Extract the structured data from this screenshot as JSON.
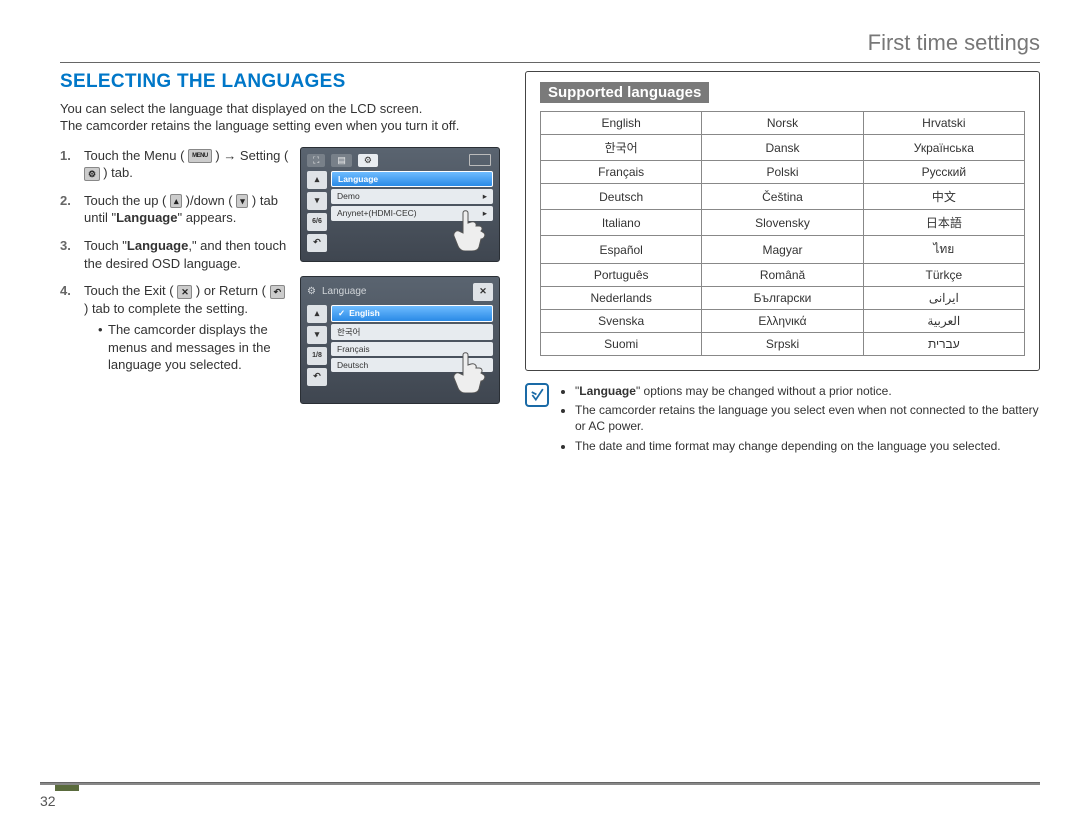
{
  "page_number": "32",
  "header": {
    "title": "First time settings"
  },
  "main": {
    "section_title": "SELECTING THE LANGUAGES",
    "intro_line1": "You can select the language that displayed on the LCD screen.",
    "intro_line2": "The camcorder retains the language setting even when you turn it off.",
    "steps": [
      {
        "num": "1.",
        "pre": "Touch the Menu (",
        "icon1_name": "menu-icon",
        "icon1_label": "MENU",
        "mid": " ) → Setting (",
        "icon2_name": "gear-icon",
        "icon2_label": "⚙",
        "post": " ) tab."
      },
      {
        "num": "2.",
        "pre": "Touch the up (",
        "icon1_name": "chevron-up-icon",
        "icon1_label": "▴",
        "mid": " )/down (",
        "icon2_name": "chevron-down-icon",
        "icon2_label": "▾",
        "post": " ) tab until \"",
        "bold": "Language",
        "tail": "\" appears."
      },
      {
        "num": "3.",
        "pre": "Touch \"",
        "bold": "Language",
        "post": ",\" and then touch the desired OSD language."
      },
      {
        "num": "4.",
        "pre": "Touch the Exit (",
        "icon1_name": "close-icon",
        "icon1_label": "✕",
        "mid": " ) or Return (",
        "icon2_name": "return-icon",
        "icon2_label": "↶",
        "post": " ) tab to complete the setting.",
        "bullet": "The camcorder displays the menus and messages in the language you selected."
      }
    ],
    "screenshot1": {
      "page_indicator": "6/6",
      "rows": [
        "Language",
        "Demo",
        "Anynet+(HDMI-CEC)"
      ],
      "title": ""
    },
    "screenshot2": {
      "title": "Language",
      "page_indicator": "1/8",
      "rows": [
        "English",
        "한국어",
        "Français",
        "Deutsch"
      ]
    }
  },
  "right": {
    "supported_title": "Supported languages",
    "languages": [
      [
        "English",
        "Norsk",
        "Hrvatski"
      ],
      [
        "한국어",
        "Dansk",
        "Українська"
      ],
      [
        "Français",
        "Polski",
        "Русский"
      ],
      [
        "Deutsch",
        "Čeština",
        "中文"
      ],
      [
        "Italiano",
        "Slovensky",
        "日本語"
      ],
      [
        "Español",
        "Magyar",
        "ไทย"
      ],
      [
        "Português",
        "Română",
        "Türkçe"
      ],
      [
        "Nederlands",
        "Български",
        "ايرانى"
      ],
      [
        "Svenska",
        "Ελληνικά",
        "العربية"
      ],
      [
        "Suomi",
        "Srpski",
        "עברית"
      ]
    ],
    "notes": [
      "\"Language\" options may be changed without a prior notice.",
      "The camcorder retains the language you select even when not connected to the battery or AC power.",
      "The date and time format may change depending on the language you selected."
    ],
    "note_bold_word": "Language"
  }
}
